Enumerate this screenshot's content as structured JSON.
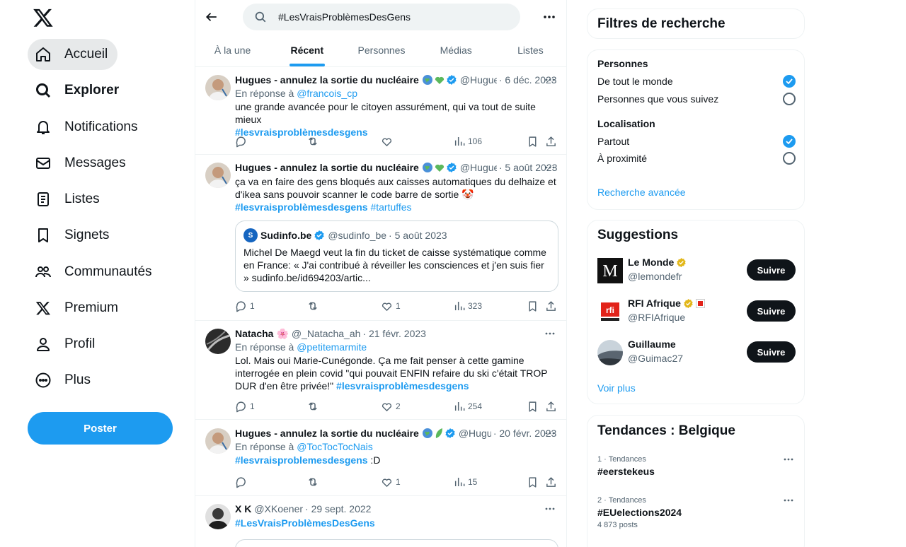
{
  "nav": {
    "items": [
      {
        "label": "Accueil",
        "icon": "home-icon"
      },
      {
        "label": "Explorer",
        "icon": "search-icon"
      },
      {
        "label": "Notifications",
        "icon": "bell-icon"
      },
      {
        "label": "Messages",
        "icon": "mail-icon"
      },
      {
        "label": "Listes",
        "icon": "list-icon"
      },
      {
        "label": "Signets",
        "icon": "bookmark-icon"
      },
      {
        "label": "Communautés",
        "icon": "people-icon"
      },
      {
        "label": "Premium",
        "icon": "x-logo-icon"
      },
      {
        "label": "Profil",
        "icon": "user-icon"
      },
      {
        "label": "Plus",
        "icon": "more-circle-icon"
      }
    ],
    "post_button": "Poster"
  },
  "search": {
    "value": "#LesVraisProblèmesDesGens"
  },
  "tabs": [
    "À la une",
    "Récent",
    "Personnes",
    "Médias",
    "Listes"
  ],
  "tweets": [
    {
      "name": "Hugues - annulez la sortie du nucléaire",
      "handle": "@Hugue",
      "date": "· 6 déc. 2023",
      "reply_prefix": "En réponse à",
      "reply_to": "@francois_cp",
      "text": "une grande avancée pour le citoyen assurément, qui va tout de suite mieux",
      "hashtag": "#lesvraisproblèmesdesgens",
      "views": "106"
    },
    {
      "name": "Hugues - annulez la sortie du nucléaire",
      "handle": "@Hugue",
      "date": "· 5 août 2023",
      "text": "ça va en faire des gens bloqués aux caisses automatiques du delhaize et d'ikea sans pouvoir scanner le code barre de sortie 🤡",
      "hashtag": "#lesvraisproblèmesdesgens",
      "hashtag2": "#tartuffes",
      "quote": {
        "avatar_text": "S",
        "name": "Sudinfo.be",
        "handle": "@sudinfo_be",
        "date": "· 5 août 2023",
        "text": "Michel De Maegd veut la fin du ticket de caisse systématique comme en France: « J'ai contribué à réveiller les consciences et j'en suis fier » sudinfo.be/id694203/artic..."
      },
      "replies": "1",
      "likes": "1",
      "views": "323"
    },
    {
      "name": "Natacha",
      "emoji": "🌸",
      "handle": "@_Natacha_ah",
      "date": "· 21 févr. 2023",
      "reply_prefix": "En réponse à",
      "reply_to": "@petitemarmite",
      "text": "Lol. Mais oui Marie-Cunégonde. Ça me fait penser à cette gamine interrogée en plein covid \"qui pouvait ENFIN refaire du ski c'était TROP DUR d'en être privée!\"",
      "hashtag": "#lesvraisproblèmesdesgens",
      "replies": "1",
      "likes": "2",
      "views": "254"
    },
    {
      "name": "Hugues - annulez la sortie du nucléaire",
      "handle": "@Hugu",
      "date": "· 20 févr. 2023",
      "reply_prefix": "En réponse à",
      "reply_to": "@TocTocTocNais",
      "hashtag": "#lesvraisproblemesdesgens",
      "suffix": " :D",
      "likes": "1",
      "views": "15"
    },
    {
      "name": "X K",
      "handle": "@XKoener",
      "date": "· 29 sept. 2022",
      "hashtag": "#LesVraisProblèmesDesGens"
    }
  ],
  "filters": {
    "title": "Filtres de recherche",
    "people_title": "Personnes",
    "people_options": [
      "De tout le monde",
      "Personnes que vous suivez"
    ],
    "location_title": "Localisation",
    "location_options": [
      "Partout",
      "À proximité"
    ],
    "advanced": "Recherche avancée"
  },
  "suggestions": {
    "title": "Suggestions",
    "items": [
      {
        "name": "Le Monde",
        "handle": "@lemondefr",
        "follow": "Suivre"
      },
      {
        "name": "RFI Afrique",
        "handle": "@RFIAfrique",
        "follow": "Suivre"
      },
      {
        "name": "Guillaume",
        "handle": "@Guimac27",
        "follow": "Suivre"
      }
    ],
    "more": "Voir plus"
  },
  "trends": {
    "title": "Tendances : Belgique",
    "items": [
      {
        "meta": "1 · Tendances",
        "name": "#eerstekeus"
      },
      {
        "meta": "2 · Tendances",
        "name": "#EUelections2024",
        "posts": "4 873 posts"
      }
    ]
  },
  "colors": {
    "accent": "#1d9bf0",
    "text": "#0f1419",
    "secondary": "#536471",
    "border": "#eff3f4"
  }
}
